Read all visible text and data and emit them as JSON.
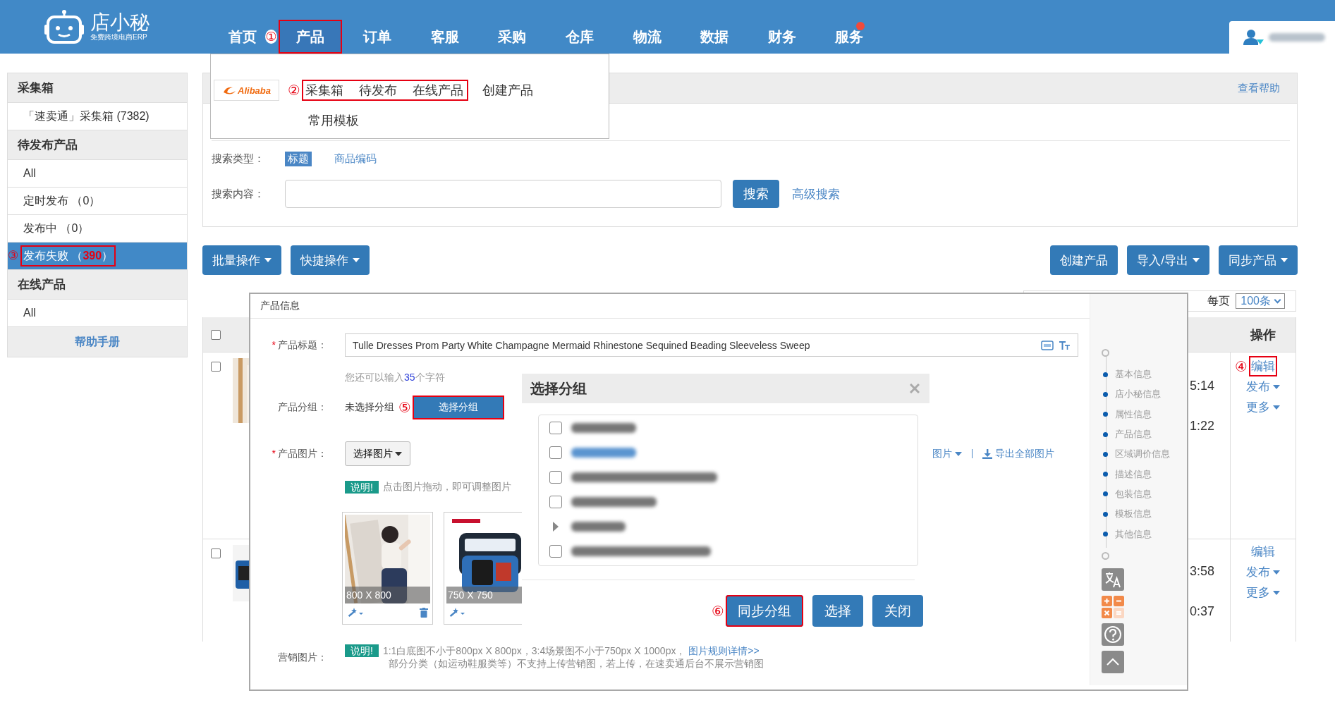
{
  "header": {
    "logo_title": "店小秘",
    "logo_subtitle": "免费跨境电商ERP",
    "nav": [
      {
        "label": "首页",
        "selected": false,
        "outlined": false,
        "badge": false
      },
      {
        "label": "产品",
        "selected": true,
        "outlined": true,
        "badge": false,
        "annotation": "①"
      },
      {
        "label": "订单",
        "selected": false,
        "outlined": false,
        "badge": false
      },
      {
        "label": "客服",
        "selected": false,
        "outlined": false,
        "badge": false
      },
      {
        "label": "采购",
        "selected": false,
        "outlined": false,
        "badge": false
      },
      {
        "label": "仓库",
        "selected": false,
        "outlined": false,
        "badge": false
      },
      {
        "label": "物流",
        "selected": false,
        "outlined": false,
        "badge": false
      },
      {
        "label": "数据",
        "selected": false,
        "outlined": false,
        "badge": false
      },
      {
        "label": "财务",
        "selected": false,
        "outlined": false,
        "badge": false
      },
      {
        "label": "服务",
        "selected": false,
        "outlined": false,
        "badge": true
      }
    ]
  },
  "product_menu": {
    "logo": "Alibaba",
    "annotation": "②",
    "rows": [
      [
        {
          "label": "采集箱",
          "outlined": true
        },
        {
          "label": "待发布",
          "outlined": true
        },
        {
          "label": "在线产品",
          "outlined": true
        },
        {
          "label": "创建产品",
          "outlined": false
        }
      ],
      [
        {
          "label": "常用模板",
          "outlined": false
        }
      ]
    ]
  },
  "sidebar": {
    "sections": [
      {
        "title": "采集箱",
        "items": [
          {
            "label": "「速卖通」采集箱 (7382)",
            "selected": false,
            "outlined": false
          }
        ]
      },
      {
        "title": "待发布产品",
        "items": [
          {
            "label": "All",
            "selected": false,
            "outlined": false
          },
          {
            "label": "定时发布 （0）",
            "selected": false,
            "outlined": false
          },
          {
            "label": "发布中 （0）",
            "selected": false,
            "outlined": false
          },
          {
            "label": "发布失败 （**390**）",
            "selected": true,
            "outlined": true,
            "annotation": "③"
          }
        ]
      },
      {
        "title": "在线产品",
        "items": [
          {
            "label": "All",
            "selected": false,
            "outlined": false
          }
        ]
      }
    ],
    "help_link": "帮助手册"
  },
  "help_bar": {
    "link": "查看帮助"
  },
  "search": {
    "type_label": "搜索类型：",
    "types": [
      {
        "label": "标题",
        "selected": true
      },
      {
        "label": "商品编码",
        "selected": false
      }
    ],
    "content_label": "搜索内容：",
    "button": "搜索",
    "advanced": "高级搜索"
  },
  "toolbar": {
    "left": [
      {
        "label": "批量操作",
        "dropdown": true
      },
      {
        "label": "快捷操作",
        "dropdown": true
      }
    ],
    "right": [
      {
        "label": "创建产品",
        "dropdown": false
      },
      {
        "label": "导入/导出",
        "dropdown": true
      },
      {
        "label": "同步产品",
        "dropdown": true
      }
    ]
  },
  "pagination": {
    "per_page_label": "每页",
    "per_page": "100条"
  },
  "table": {
    "select_all": false,
    "columns": [
      {
        "label": "操作"
      }
    ],
    "rows": [
      {
        "checked": false,
        "times": [
          "5:14",
          "1:22"
        ],
        "actions": [
          {
            "label": "编辑",
            "kind": "link",
            "outlined": true,
            "annotation": "④"
          },
          {
            "label": "发布",
            "kind": "menu",
            "outlined": false
          },
          {
            "label": "更多",
            "kind": "menu",
            "outlined": false
          }
        ]
      },
      {
        "checked": false,
        "times": [
          "3:58",
          "0:37"
        ],
        "actions": [
          {
            "label": "编辑",
            "kind": "link",
            "outlined": false
          },
          {
            "label": "发布",
            "kind": "menu",
            "outlined": false
          },
          {
            "label": "更多",
            "kind": "menu",
            "outlined": false
          }
        ]
      }
    ]
  },
  "product_info": {
    "title": "产品信息",
    "title_field": {
      "required_mark": "*",
      "label": "产品标题：",
      "value": "Tulle Dresses Prom Party White Champagne Mermaid Rhinestone Sequined Beading Sleeveless Sweep"
    },
    "hint": {
      "before": "您还可以输入",
      "count": "35",
      "after": "个字符"
    },
    "group_field": {
      "label": "产品分组：",
      "value": "未选择分组",
      "button": "选择分组",
      "outlined": true,
      "annotation": "⑤"
    },
    "image_field": {
      "required_mark": "*",
      "label": "产品图片：",
      "button": "选择图片",
      "menu": "图片",
      "export": "导出全部图片",
      "note_tag": "说明!",
      "note": "点击图片拖动，即可调整图片",
      "images": [
        {
          "size": "800 X 800",
          "deletable": true
        },
        {
          "size": "750 X 750"
        }
      ]
    },
    "marketing_field": {
      "label": "营销图片：",
      "note_tag": "说明!",
      "note_line1": "1:1白底图不小于800px X 800px，3:4场景图不小于750px X 1000px，",
      "link": "图片规则详情>>",
      "note_line2": "部分分类（如运动鞋服类等）不支持上传营销图，若上传，在速卖通后台不展示营销图"
    },
    "steps": [
      "基本信息",
      "店小秘信息",
      "属性信息",
      "产品信息",
      "区域调价信息",
      "描述信息",
      "包装信息",
      "模板信息",
      "其他信息"
    ]
  },
  "group_dialog": {
    "title": "选择分组",
    "groups": [
      {
        "kind": "checkbox",
        "checked": false,
        "color": "#777777"
      },
      {
        "kind": "checkbox",
        "checked": false,
        "color": "#5b95d0"
      },
      {
        "kind": "checkbox",
        "checked": false,
        "color": "#777777"
      },
      {
        "kind": "checkbox",
        "checked": false,
        "color": "#777777"
      },
      {
        "kind": "folder",
        "expanded": false,
        "color": "#777777"
      },
      {
        "kind": "checkbox",
        "checked": false,
        "color": "#777777"
      }
    ],
    "buttons": [
      {
        "label": "同步分组",
        "outlined": true,
        "annotation": "⑥"
      },
      {
        "label": "选择",
        "outlined": false
      },
      {
        "label": "关闭",
        "outlined": false
      }
    ]
  }
}
